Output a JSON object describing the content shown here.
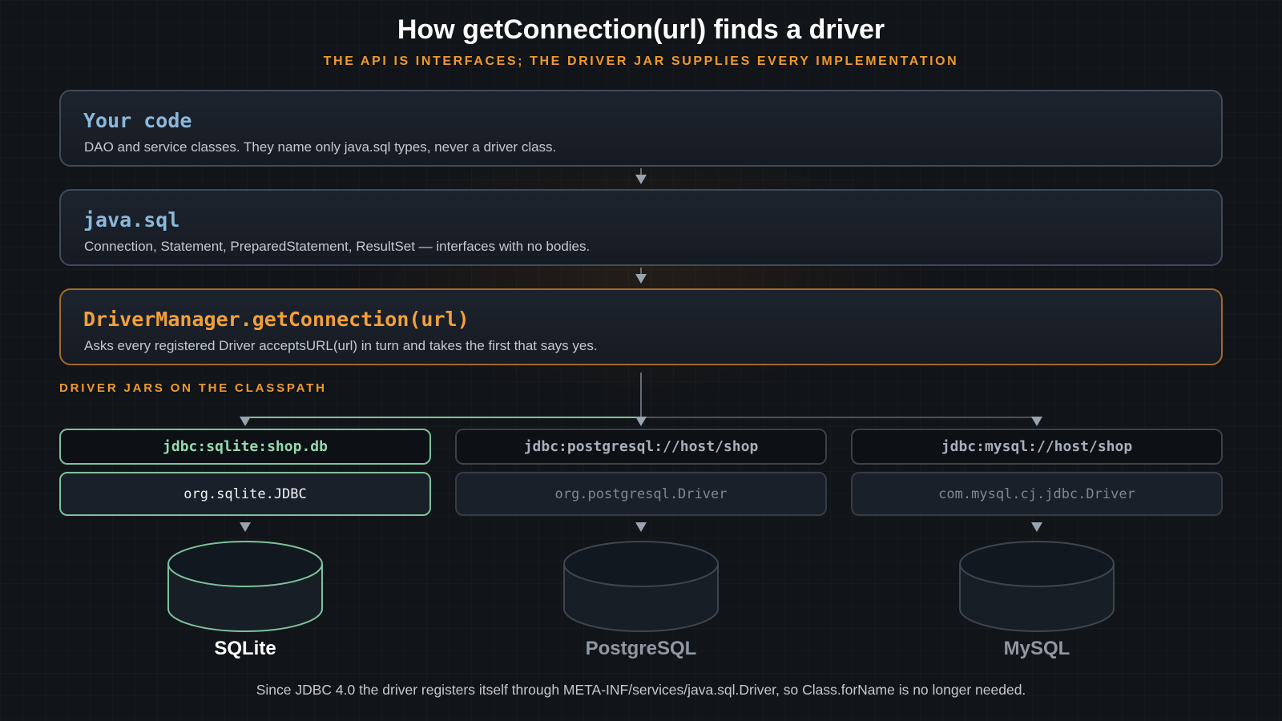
{
  "header": {
    "title": "How getConnection(url) finds a driver",
    "subtitle": "THE API IS INTERFACES; THE DRIVER JAR SUPPLIES EVERY IMPLEMENTATION"
  },
  "layers": [
    {
      "title": "Your code",
      "description": "DAO and service classes. They name only java.sql types, never a driver class."
    },
    {
      "title": "java.sql",
      "description": "Connection, Statement, PreparedStatement, ResultSet — interfaces with no bodies."
    },
    {
      "title": "DriverManager.getConnection(url)",
      "description": "Asks every registered Driver acceptsURL(url) in turn and takes the first that says yes."
    }
  ],
  "section_label": "DRIVER JARS ON THE CLASSPATH",
  "drivers": [
    {
      "url": "jdbc:sqlite:shop.db",
      "driver_class": "org.sqlite.JDBC",
      "database": "SQLite",
      "selected": true
    },
    {
      "url": "jdbc:postgresql://host/shop",
      "driver_class": "org.postgresql.Driver",
      "database": "PostgreSQL",
      "selected": false
    },
    {
      "url": "jdbc:mysql://host/shop",
      "driver_class": "com.mysql.cj.jdbc.Driver",
      "database": "MySQL",
      "selected": false
    }
  ],
  "footnote": "Since JDBC 4.0 the driver registers itself through META-INF/services/java.sql.Driver, so Class.forName is no longer needed.",
  "colors": {
    "accent_orange": "#f09a2c",
    "selected_green": "#7cc29a",
    "layer_title_blue": "#8bb8dc",
    "background": "#111418"
  }
}
